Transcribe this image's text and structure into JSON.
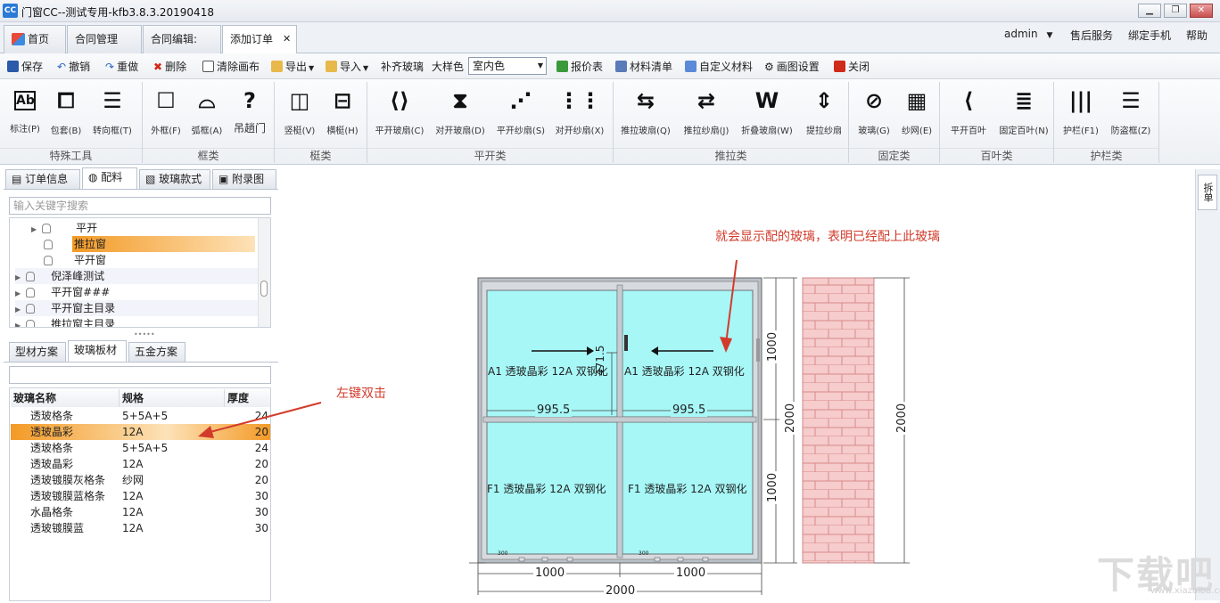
{
  "window": {
    "title": "门窗CC--测试专用-kfb3.8.3.20190418",
    "logo": "CC"
  },
  "tabs": [
    {
      "label": "首页"
    },
    {
      "label": "合同管理"
    },
    {
      "label": "合同编辑:"
    },
    {
      "label": "添加订单",
      "close": "✕"
    }
  ],
  "top_menu": {
    "user": "admin",
    "service": "售后服务",
    "bind_phone": "绑定手机",
    "help": "帮助"
  },
  "toolbar": {
    "save": "保存",
    "undo": "撤销",
    "redo": "重做",
    "delete": "删除",
    "clear": "清除画布",
    "export": "导出",
    "import": "导入",
    "fill_glass": "补齐玻璃",
    "sample_label": "大样色",
    "color_value": "室内色",
    "quote": "报价表",
    "materials": "材料清单",
    "custom_material": "自定义材料",
    "draw_settings": "画图设置",
    "close": "关闭"
  },
  "ribbon": {
    "groups": {
      "special": "特殊工具",
      "frame": "框类",
      "mullion": "梃类",
      "casement": "平开类",
      "sliding": "推拉类",
      "fixed": "固定类",
      "louver": "百叶类",
      "guard": "护栏类"
    },
    "buttons": {
      "mark": "标注(P)",
      "cover": "包套(B)",
      "transfer": "转向框(T)",
      "outer": "外框(F)",
      "arc": "弧框(A)",
      "hang": "吊趟门",
      "vmullion": "竖梃(V)",
      "hmullion": "横梃(H)",
      "cglass": "平开玻扇(C)",
      "dglass": "对开玻扇(D)",
      "sscreen": "平开纱扇(S)",
      "xscreen": "对开纱扇(X)",
      "qglass": "推拉玻扇(Q)",
      "jscreen": "推拉纱扇(J)",
      "wfold": "折叠玻扇(W)",
      "lift": "提拉纱扇",
      "glass": "玻璃(G)",
      "mesh": "纱网(E)",
      "louver_c": "平开百叶",
      "louver_f": "固定百叶(N)",
      "rail": "护栏(F1)",
      "theft": "防盗框(Z)"
    }
  },
  "panel": {
    "tabs": [
      "订单信息",
      "配料",
      "玻璃款式",
      "附录图"
    ],
    "search_placeholder": "输入关键字搜索",
    "tree": [
      "平开",
      "推拉窗",
      "平开窗",
      "倪泽峰测试",
      "平开窗###",
      "平开窗主目录",
      "推拉窗主目录"
    ],
    "subtabs": [
      "型材方案",
      "玻璃板材",
      "五金方案"
    ],
    "table_headers": [
      "玻璃名称",
      "规格",
      "厚度"
    ],
    "rows": [
      {
        "name": "透玻格条",
        "spec": "5+5A+5",
        "thick": "24"
      },
      {
        "name": "透玻晶彩",
        "spec": "12A",
        "thick": "20"
      },
      {
        "name": "透玻格条",
        "spec": "5+5A+5",
        "thick": "24"
      },
      {
        "name": "透玻晶彩",
        "spec": "12A",
        "thick": "20"
      },
      {
        "name": "透玻镀膜灰格条",
        "spec": "纱网",
        "thick": "20"
      },
      {
        "name": "透玻镀膜蓝格条",
        "spec": "12A",
        "thick": "30"
      },
      {
        "name": "水晶格条",
        "spec": "12A",
        "thick": "30"
      },
      {
        "name": "透玻镀膜蓝",
        "spec": "12A",
        "thick": "30"
      }
    ],
    "selected_row": 1
  },
  "drawing": {
    "pane_top_left": "A1 透玻晶彩  12A 双钢化",
    "pane_top_right": "A1 透玻晶彩  12A 双钢化",
    "pane_bottom_left": "F1 透玻晶彩  12A 双钢化",
    "pane_bottom_right": "F1 透玻晶彩  12A 双钢化",
    "dim_top_left": "995.5",
    "dim_top_right": "995.5",
    "dim_mid": "471.5",
    "dim_right_upper": "1000",
    "dim_right_lower": "1000",
    "dim_right_total": "2000",
    "dim_wall": "2000",
    "dim_bottom_left": "1000",
    "dim_bottom_right": "1000",
    "dim_bottom_total": "2000",
    "small_left": "300",
    "small_right": "300"
  },
  "annotations": {
    "top": "就会显示配的玻璃，表明已经配上此玻璃",
    "left": "左键双击"
  },
  "side_strip": "拆单",
  "watermark": {
    "logo": "下载吧",
    "url": "www.xiazaiba.com"
  },
  "colors": {
    "glass": "#a7f7f7",
    "frame": "#b9c0c7",
    "annotation": "#d23b2b",
    "selection": "#f39a26",
    "wall": "#f6cccc"
  }
}
